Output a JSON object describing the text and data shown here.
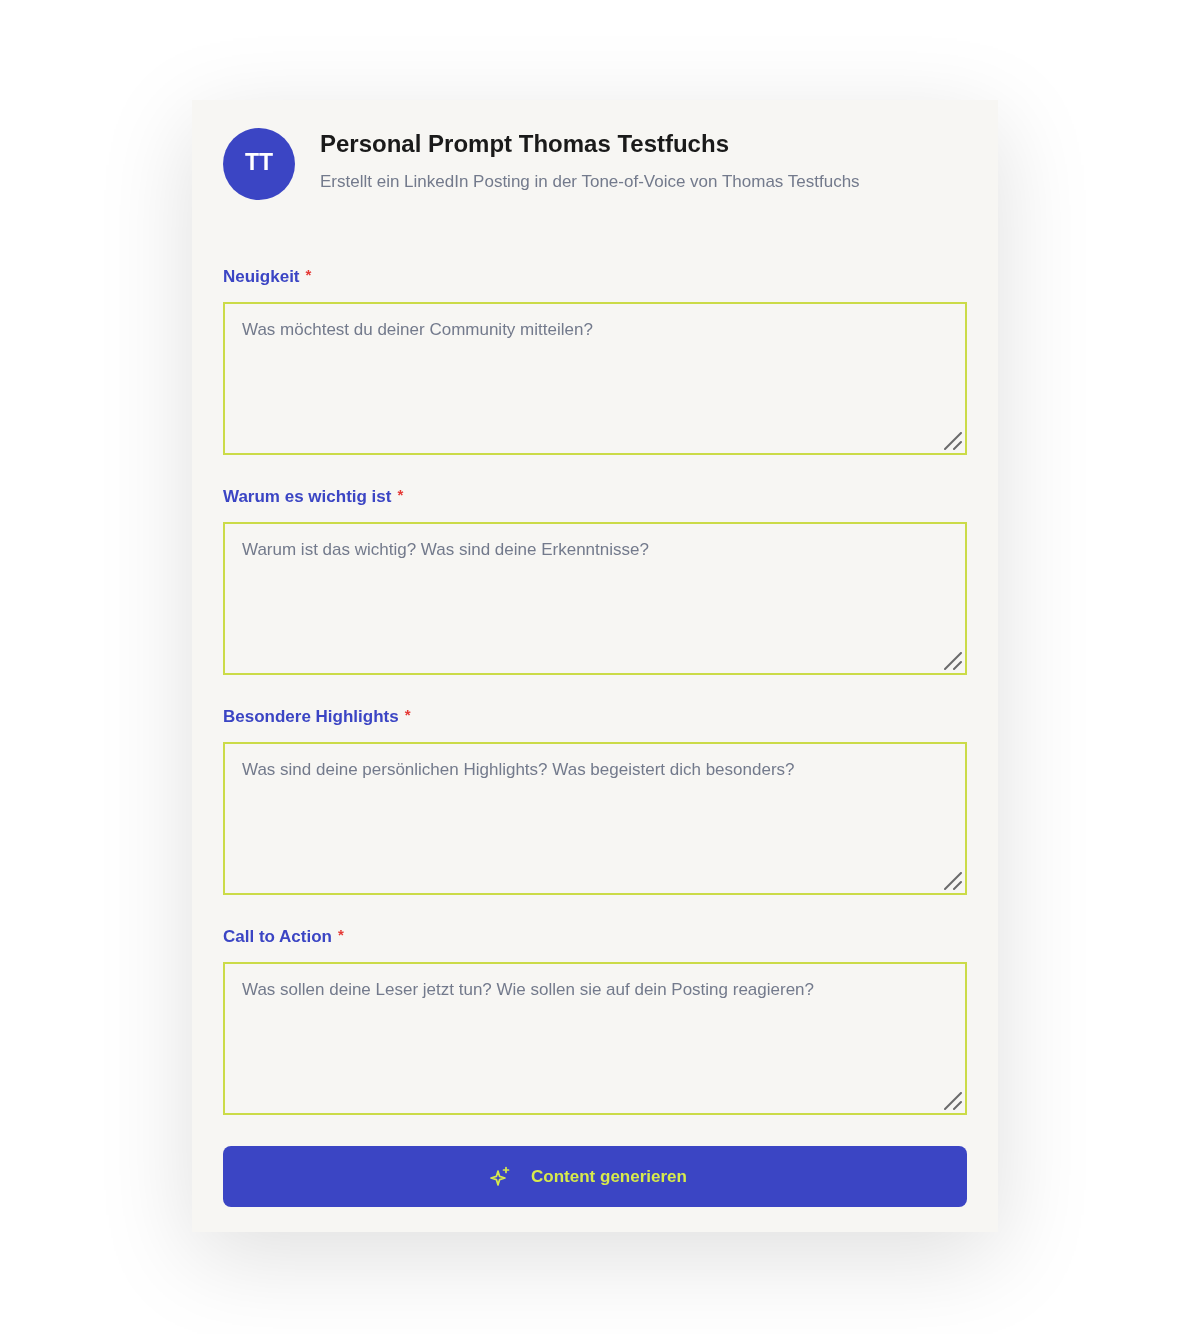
{
  "header": {
    "avatar": {
      "initials": "TT"
    },
    "title": "Personal Prompt Thomas Testfuchs",
    "subtitle": "Erstellt ein LinkedIn Posting in der Tone-of-Voice von Thomas Testfuchs"
  },
  "fields": [
    {
      "label": "Neuigkeit",
      "required_mark": "*",
      "placeholder": "Was möchtest du deiner Community mitteilen?"
    },
    {
      "label": "Warum es wichtig ist",
      "required_mark": "*",
      "placeholder": "Warum ist das wichtig? Was sind deine Erkenntnisse?"
    },
    {
      "label": "Besondere Highlights",
      "required_mark": "*",
      "placeholder": "Was sind deine persönlichen Highlights? Was begeistert dich besonders?"
    },
    {
      "label": "Call to Action",
      "required_mark": "*",
      "placeholder": "Was sollen deine Leser jetzt tun? Wie sollen sie auf dein Posting reagieren?"
    }
  ],
  "submit_button": {
    "label": "Content generieren"
  }
}
